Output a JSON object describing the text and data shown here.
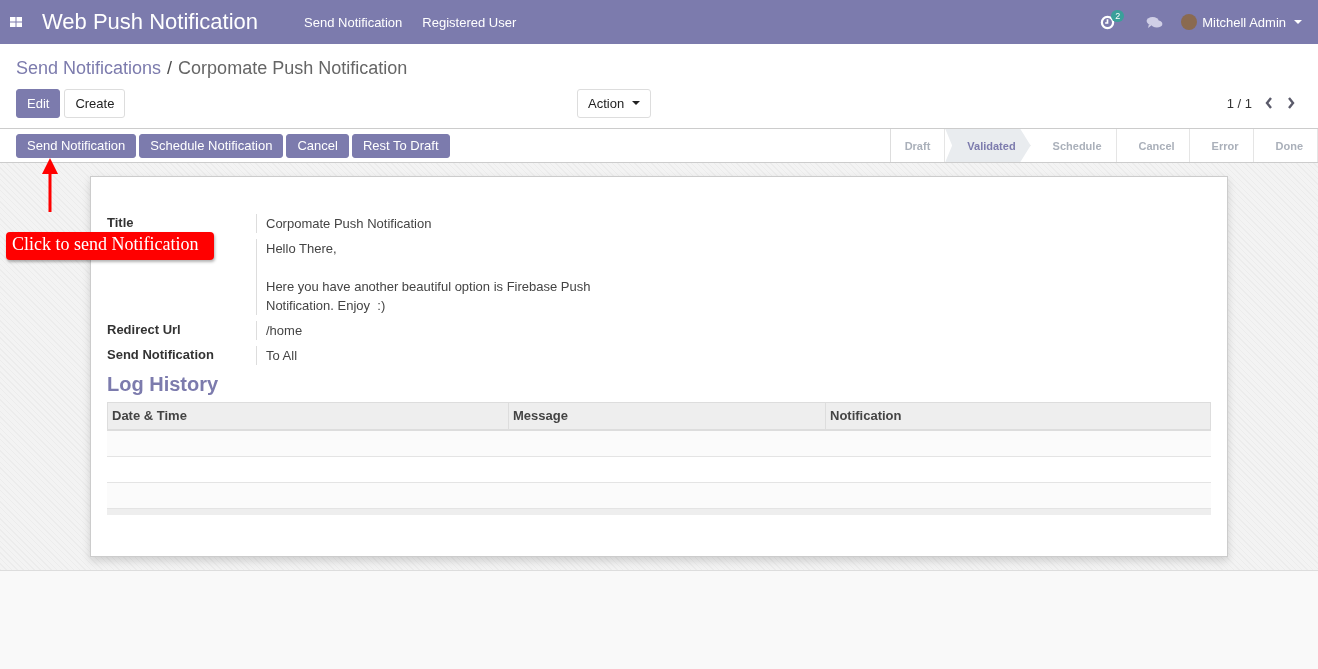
{
  "navbar": {
    "app_title": "Web Push Notification",
    "menu": [
      {
        "label": "Send Notification"
      },
      {
        "label": "Registered User"
      }
    ],
    "activity_count": "2",
    "user": "Mitchell Admin"
  },
  "breadcrumb": {
    "parent": "Send Notifications",
    "separator": "/",
    "current": "Corpomate Push Notification"
  },
  "toolbar": {
    "edit": "Edit",
    "create": "Create",
    "action": "Action",
    "pager": "1 / 1"
  },
  "header_buttons": [
    {
      "label": "Send Notification"
    },
    {
      "label": "Schedule Notification"
    },
    {
      "label": "Cancel"
    },
    {
      "label": "Rest To Draft"
    }
  ],
  "stages": [
    {
      "label": "Draft",
      "selected": false
    },
    {
      "label": "Validated",
      "selected": true
    },
    {
      "label": "Schedule",
      "selected": false
    },
    {
      "label": "Cancel",
      "selected": false
    },
    {
      "label": "Error",
      "selected": false
    },
    {
      "label": "Done",
      "selected": false
    }
  ],
  "fields": [
    {
      "label": "Title",
      "value": "Corpomate Push Notification"
    },
    {
      "value": "Hello There,\n\nHere you have another beautiful option is Firebase Push\nNotification. Enjoy  :)"
    },
    {
      "label": "Redirect Url",
      "value": "/home"
    },
    {
      "label": "Send Notification",
      "value": "To All"
    }
  ],
  "log_history": {
    "title": "Log History",
    "columns": [
      "Date & Time",
      "Message",
      "Notification"
    ]
  },
  "annotation": {
    "text": "Click to send Notification"
  }
}
